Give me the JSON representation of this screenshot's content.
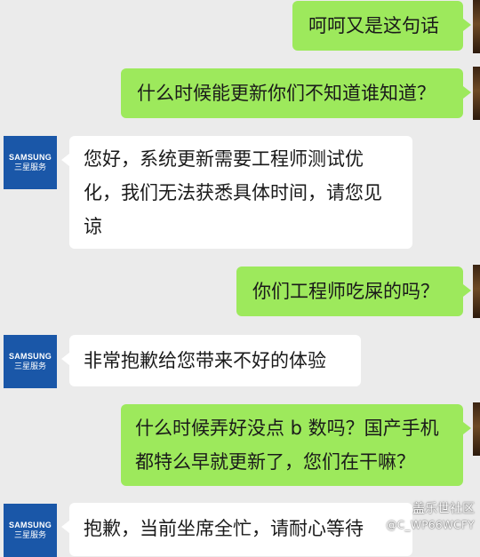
{
  "contact": {
    "avatar_brand": "SAMSUNG",
    "avatar_subtitle": "三星服务"
  },
  "messages": [
    {
      "from": "user",
      "text": "呵呵又是这句话"
    },
    {
      "from": "user",
      "text": "什么时候能更新你们不知道谁知道？"
    },
    {
      "from": "agent",
      "text": "您好，系统更新需要工程师测试优\n化，我们无法获悉具体时间，请您见\n谅"
    },
    {
      "from": "user",
      "text": "你们工程师吃屎的吗？"
    },
    {
      "from": "agent",
      "text": "非常抱歉给您带来不好的体验"
    },
    {
      "from": "user",
      "text": "什么时候弄好没点 b 数吗？国产手机\n都特么早就更新了，您们在干嘛？"
    },
    {
      "from": "agent",
      "text": "抱歉，当前坐席全忙，请耐心等待"
    }
  ],
  "watermark": {
    "site": "盖乐世社区",
    "user": "@C_WP66WCFY"
  },
  "colors": {
    "background": "#ebebeb",
    "outgoing_bubble": "#9de95c",
    "incoming_bubble": "#ffffff",
    "avatar_bg": "#1a57a8"
  }
}
